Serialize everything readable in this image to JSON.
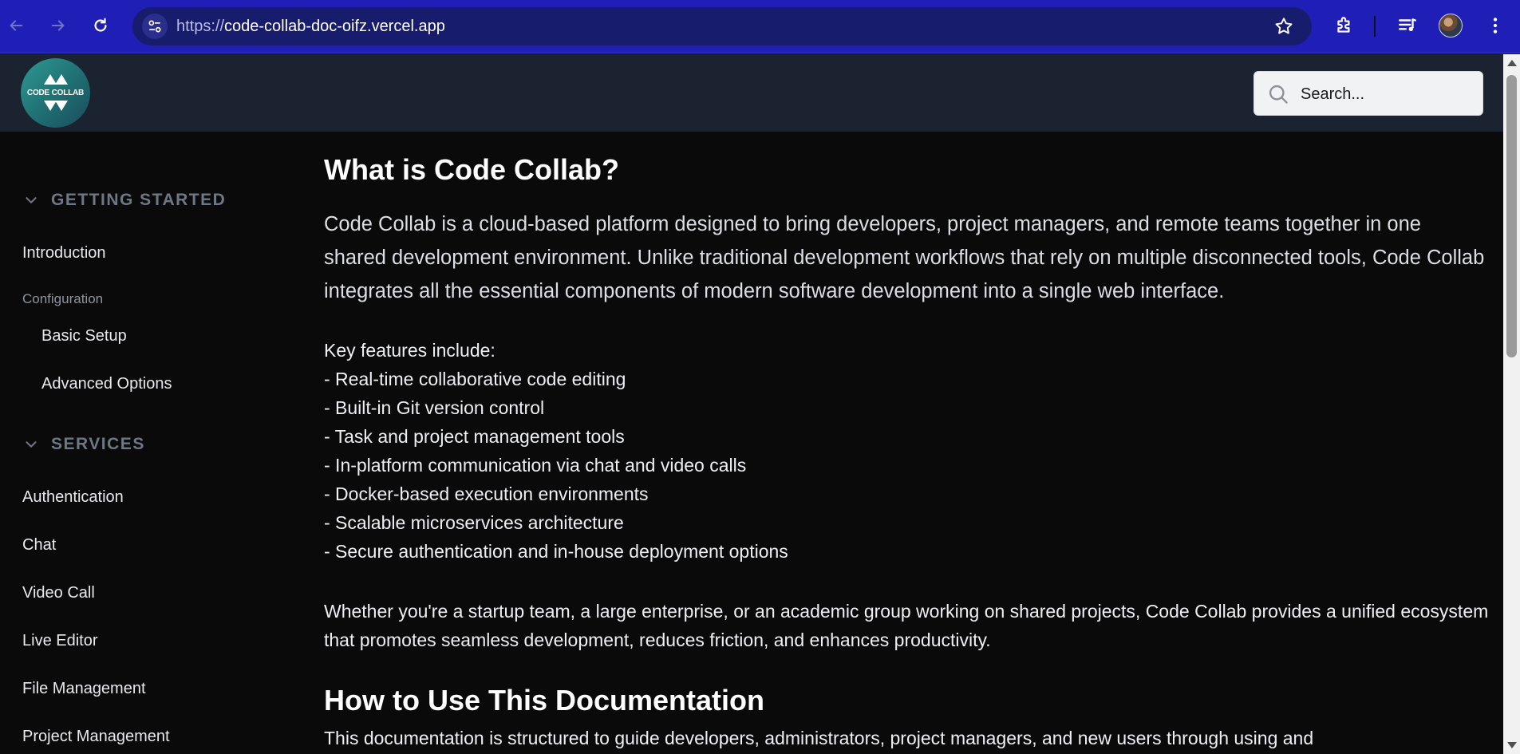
{
  "browser": {
    "url_scheme": "https://",
    "url_host": "code-collab-doc-oifz.vercel.app",
    "accent": "#1f1fb8"
  },
  "header": {
    "logo_text": "CODE COLLAB",
    "search_placeholder": "Search..."
  },
  "sidebar": {
    "sections": [
      {
        "title": "GETTING STARTED",
        "items": [
          "Introduction"
        ],
        "group_label": "Configuration",
        "sub_items": [
          "Basic Setup",
          "Advanced Options"
        ]
      },
      {
        "title": "SERVICES",
        "items": [
          "Authentication",
          "Chat",
          "Video Call",
          "Live Editor",
          "File Management",
          "Project Management"
        ]
      }
    ]
  },
  "content": {
    "title": "What is Code Collab?",
    "lead": "Code Collab is a cloud-based platform designed to bring developers, project managers, and remote teams together in one shared development environment. Unlike traditional development workflows that rely on multiple disconnected tools, Code Collab integrates all the essential components of modern software development into a single web interface.",
    "features_title": "Key features include:",
    "features": [
      "- Real-time collaborative code editing",
      "- Built-in Git version control",
      "- Task and project management tools",
      "- In-platform communication via chat and video calls",
      "- Docker-based execution environments",
      "- Scalable microservices architecture",
      "- Secure authentication and in-house deployment options"
    ],
    "closing": "Whether you're a startup team, a large enterprise, or an academic group working on shared projects, Code Collab provides a unified ecosystem that promotes seamless development, reduces friction, and enhances productivity.",
    "section2_title": "How to Use This Documentation",
    "section2_text": "This documentation is structured to guide developers, administrators, project managers, and new users through using and"
  }
}
